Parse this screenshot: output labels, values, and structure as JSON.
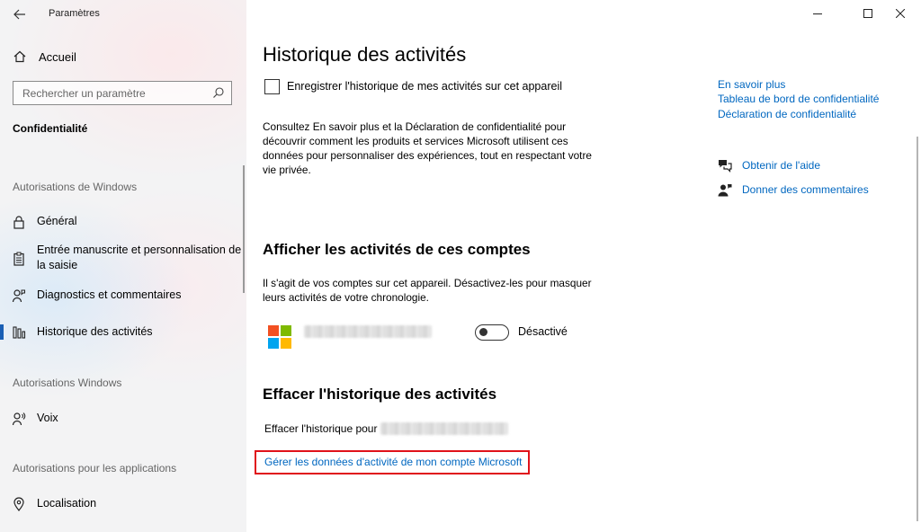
{
  "window": {
    "app_title": "Paramètres",
    "controls": [
      "minimize",
      "maximize",
      "close"
    ]
  },
  "sidebar": {
    "home_label": "Accueil",
    "search_placeholder": "Rechercher un paramètre",
    "section_title": "Confidentialité",
    "groups": [
      {
        "heading": "Autorisations de Windows",
        "items": [
          {
            "label": "Général",
            "icon": "lock-icon"
          },
          {
            "label": "Entrée manuscrite et personnalisation de la saisie",
            "icon": "clipboard-icon"
          },
          {
            "label": "Diagnostics et commentaires",
            "icon": "diagnostics-icon"
          },
          {
            "label": "Historique des activités",
            "icon": "timeline-icon",
            "selected": true
          }
        ]
      },
      {
        "heading": "Autorisations Windows",
        "items": [
          {
            "label": "Voix",
            "icon": "voice-icon"
          }
        ]
      },
      {
        "heading": "Autorisations pour les applications",
        "items": [
          {
            "label": "Localisation",
            "icon": "location-icon"
          }
        ]
      }
    ]
  },
  "main": {
    "title": "Historique des activités",
    "store_checkbox": {
      "label": "Enregistrer l'historique de mes activités sur cet appareil",
      "checked": false
    },
    "privacy_text": "Consultez En savoir plus et la Déclaration de confidentialité pour découvrir comment les produits et services Microsoft utilisent ces données pour personnaliser des expériences, tout en respectant votre vie privée.",
    "accounts": {
      "heading": "Afficher les activités de ces comptes",
      "description": "Il s'agit de vos comptes sur cet appareil. Désactivez-les pour masquer leurs activités de votre chronologie.",
      "toggle_label": "Désactivé",
      "toggle_on": false
    },
    "clear": {
      "heading": "Effacer l'historique des activités",
      "label": "Effacer l'historique pour",
      "manage_link": "Gérer les données d'activité de mon compte Microsoft"
    }
  },
  "right": {
    "links": [
      "En savoir plus",
      "Tableau de bord de confidentialité",
      "Déclaration de confidentialité"
    ],
    "help_label": "Obtenir de l'aide",
    "feedback_label": "Donner des commentaires"
  },
  "colors": {
    "accent": "#0067c0",
    "highlight_box": "#e0121a",
    "ms_red": "#f25022",
    "ms_green": "#7fba00",
    "ms_blue": "#00a4ef",
    "ms_yellow": "#ffb900"
  }
}
